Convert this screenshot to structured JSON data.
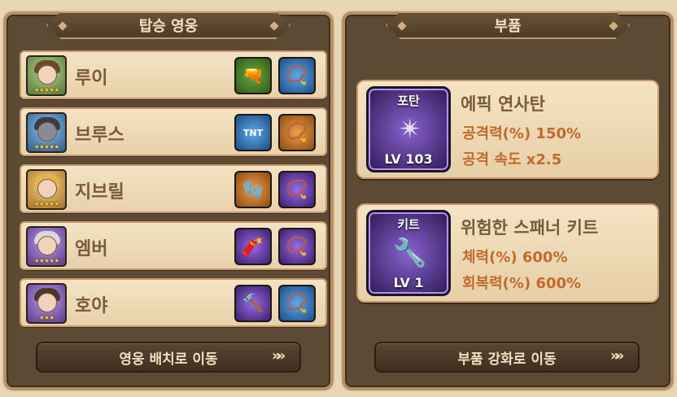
{
  "left_panel": {
    "title": "탑승 영웅",
    "heroes": [
      {
        "name": "루이",
        "stars": "★★★★★",
        "portrait_color": "green",
        "slot1_icon": "pistol-icon",
        "slot1_color": "green",
        "slot2_icon": "necklace-icon",
        "slot2_color": "blue"
      },
      {
        "name": "브루스",
        "stars": "★★★★★",
        "portrait_color": "blue",
        "slot1_icon": "tnt-barrel-icon",
        "slot1_color": "blue",
        "slot2_icon": "necklace-icon",
        "slot2_color": "orange"
      },
      {
        "name": "지브릴",
        "stars": "★★★★★",
        "portrait_color": "gold",
        "slot1_icon": "gauntlet-icon",
        "slot1_color": "orange",
        "slot2_icon": "necklace-icon",
        "slot2_color": "purple"
      },
      {
        "name": "엠버",
        "stars": "★★★★★",
        "portrait_color": "purple",
        "slot1_icon": "cannon-icon",
        "slot1_color": "purple",
        "slot2_icon": "necklace-icon",
        "slot2_color": "purple"
      },
      {
        "name": "호야",
        "stars": "★★★",
        "portrait_color": "purple",
        "slot1_icon": "hammer-icon",
        "slot1_color": "purple",
        "slot2_icon": "necklace-icon",
        "slot2_color": "blue"
      }
    ],
    "button_label": "영웅 배치로 이동"
  },
  "right_panel": {
    "title": "부품",
    "parts": [
      {
        "tag": "포탄",
        "level": "LV 103",
        "name": "에픽 연사탄",
        "stat1": "공격력(%) 150%",
        "stat2": "공격 속도 x2.5",
        "icon": "missile-icon"
      },
      {
        "tag": "키트",
        "level": "LV 1",
        "name": "위험한 스패너 키트",
        "stat1": "체력(%) 600%",
        "stat2": "회복력(%) 600%",
        "icon": "wrench-icon"
      }
    ],
    "button_label": "부품 강화로 이동"
  }
}
